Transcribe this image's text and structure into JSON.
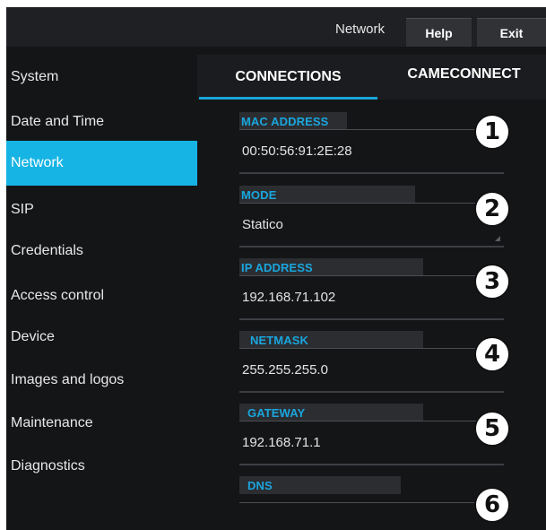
{
  "header": {
    "breadcrumb": "Network",
    "help_label": "Help",
    "exit_label": "Exit"
  },
  "sidebar": {
    "items": [
      {
        "label": "System"
      },
      {
        "label": "Date and Time"
      },
      {
        "label": "Network",
        "active": true
      },
      {
        "label": "SIP"
      },
      {
        "label": "Credentials"
      },
      {
        "label": "Access control"
      },
      {
        "label": "Device"
      },
      {
        "label": "Images and logos"
      },
      {
        "label": "Maintenance"
      },
      {
        "label": "Diagnostics"
      }
    ]
  },
  "tabs": [
    {
      "label": "CONNECTIONS",
      "active": true
    },
    {
      "label": "CAMECONNECT"
    }
  ],
  "form": {
    "fields": [
      {
        "label": "MAC ADDRESS",
        "value": "00:50:56:91:2E:28",
        "badge": "1"
      },
      {
        "label": "MODE",
        "value": "Statico",
        "badge": "2"
      },
      {
        "label": "IP ADDRESS",
        "value": "192.168.71.102",
        "badge": "3"
      },
      {
        "label": "NETMASK",
        "value": "255.255.255.0",
        "badge": "4"
      },
      {
        "label": "GATEWAY",
        "value": "192.168.71.1",
        "badge": "5"
      },
      {
        "label": "DNS",
        "value": "",
        "badge": "6"
      }
    ]
  },
  "colors": {
    "accent": "#16b4e4",
    "label": "#1aa6de",
    "background": "#141517"
  }
}
